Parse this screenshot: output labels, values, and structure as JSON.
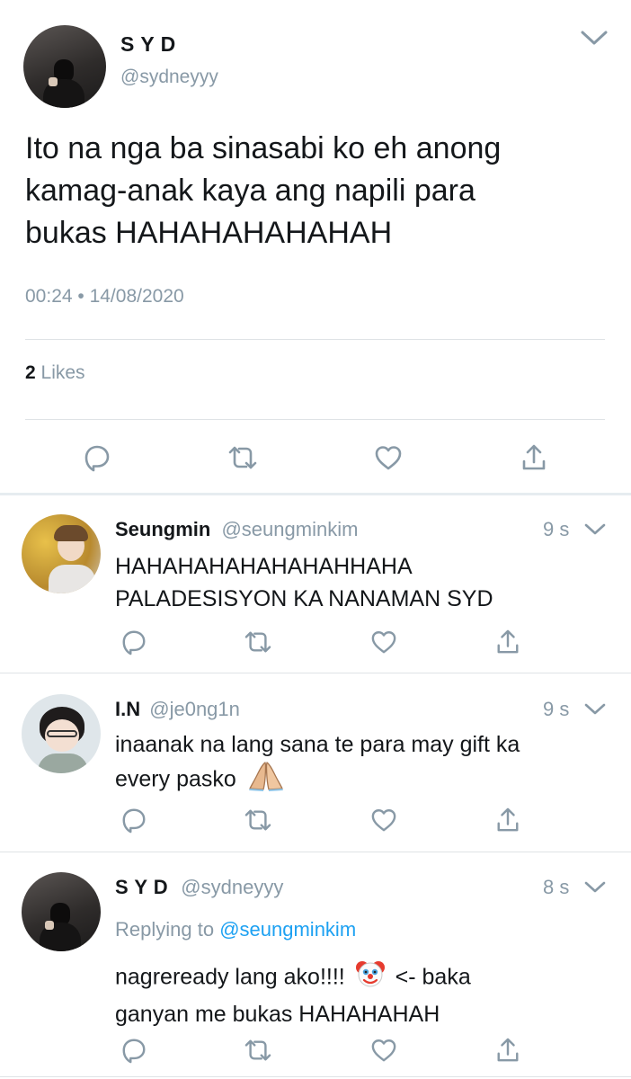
{
  "main_tweet": {
    "author_name": "S Y D",
    "author_handle": "@sydneyyy",
    "text_lines": [
      "Ito na nga ba sinasabi ko eh anong",
      "kamag-anak kaya ang napili para",
      "bukas HAHAHAHAHAHAH"
    ],
    "timestamp": "00:24 • 14/08/2020",
    "likes_count": "2",
    "likes_label": "Likes"
  },
  "replies": [
    {
      "name": "Seungmin",
      "handle": "@seungminkim",
      "time": "9 s",
      "lines": [
        "HAHAHAHAHAHAHAHHAHA",
        "PALADESISYON KA NANAMAN SYD"
      ]
    },
    {
      "name": "I.N",
      "handle": "@je0ng1n",
      "time": "9 s",
      "lines": [
        "inaanak na lang sana te para may gift ka",
        "every pasko"
      ],
      "emoji_icon": "folded-hands-icon"
    },
    {
      "name": "S Y D",
      "handle": "@sydneyyy",
      "time": "8 s",
      "replying_to_label": "Replying to",
      "replying_to_handle": "@seungminkim",
      "line1_before": "nagreready lang ako!!!!",
      "line1_after": "<- baka",
      "line2": "ganyan me bukas HAHAHAHAH",
      "emoji_icon": "clown-face-icon"
    }
  ],
  "icons": [
    "reply-icon",
    "retweet-icon",
    "like-icon",
    "share-icon",
    "chevron-down-icon"
  ],
  "colors": {
    "text": "#14171a",
    "muted": "#8899a6",
    "link": "#1da1f2",
    "divider": "#dfe3e6"
  }
}
